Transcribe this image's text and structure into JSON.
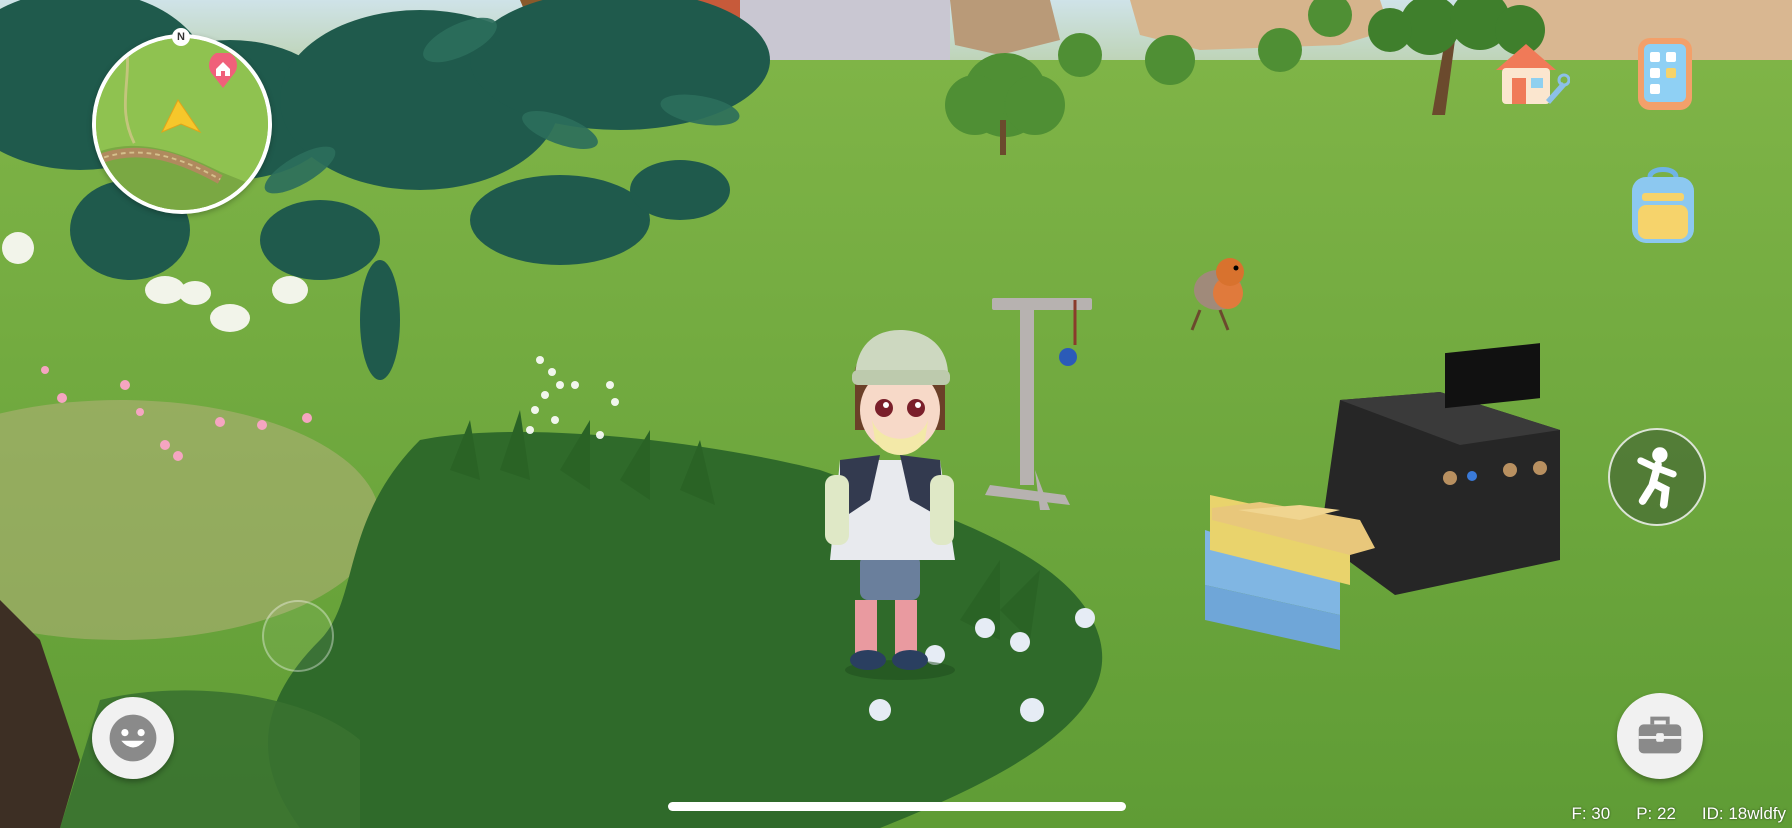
{
  "minimap": {
    "compass_label": "N",
    "home_marker_icon": "house-pin-icon",
    "player_marker_icon": "player-arrow-icon"
  },
  "hud": {
    "top_right": [
      {
        "name": "home-workshop-button",
        "icon": "house-wrench-icon"
      },
      {
        "name": "phone-menu-button",
        "icon": "phone-apps-icon"
      },
      {
        "name": "backpack-button",
        "icon": "backpack-icon"
      }
    ],
    "action_icon": "jump-pose-icon",
    "emote_icon": "smiley-face-icon",
    "toolbox_icon": "toolbox-icon"
  },
  "stats": {
    "f": "F: 30",
    "p": "P: 22",
    "id": "ID: 18wldfy"
  },
  "colors": {
    "grass": "#6ea83c",
    "shadow": "#2f6a2a",
    "leaves": "#1f5a4c"
  }
}
